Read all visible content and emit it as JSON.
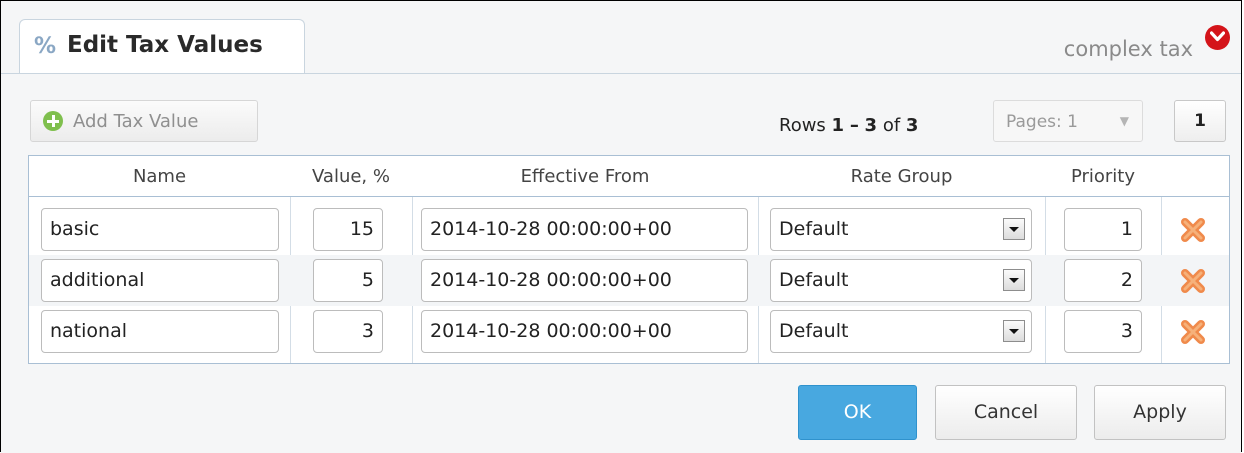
{
  "header": {
    "tab_icon": "%",
    "title": "Edit Tax Values",
    "entity_name": "complex tax"
  },
  "toolbar": {
    "add_label": "Add Tax Value",
    "rows_prefix": "Rows",
    "rows_from": "1",
    "rows_dash": "–",
    "rows_to": "3",
    "rows_of": "of",
    "rows_total": "3",
    "pages_label": "Pages: 1",
    "current_page": "1"
  },
  "table": {
    "columns": [
      "Name",
      "Value, %",
      "Effective From",
      "Rate Group",
      "Priority"
    ],
    "rows": [
      {
        "name": "basic",
        "value": "15",
        "effective_from": "2014-10-28 00:00:00+00",
        "rate_group": "Default",
        "priority": "1"
      },
      {
        "name": "additional",
        "value": "5",
        "effective_from": "2014-10-28 00:00:00+00",
        "rate_group": "Default",
        "priority": "2"
      },
      {
        "name": "national",
        "value": "3",
        "effective_from": "2014-10-28 00:00:00+00",
        "rate_group": "Default",
        "priority": "3"
      }
    ]
  },
  "footer": {
    "ok_label": "OK",
    "cancel_label": "Cancel",
    "apply_label": "Apply"
  },
  "icons": {
    "tab": "percent-icon",
    "collapse": "chevron-down-icon",
    "add": "plus-circle-icon",
    "delete": "delete-x-icon",
    "dropdown": "dropdown-arrow-icon"
  },
  "colors": {
    "accent": "#48a8e0",
    "collapse": "#d4141a",
    "delete": "#f08a4b",
    "add": "#7fbf4d"
  }
}
